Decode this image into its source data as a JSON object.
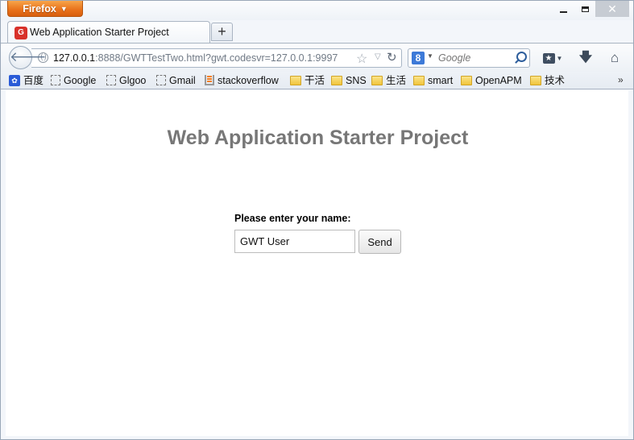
{
  "window": {
    "app_menu_label": "Firefox",
    "controls": {
      "minimize": "minimize",
      "maximize": "maximize",
      "close": "✕"
    }
  },
  "tabs": [
    {
      "title": "Web Application Starter Project",
      "active": true,
      "favicon": "gwt-favicon"
    }
  ],
  "new_tab_label": "+",
  "navbar": {
    "url_host": "127.0.0.1",
    "url_rest": ":8888/GWTTestTwo.html?gwt.codesvr=127.0.0.1:9997",
    "search_engine_icon": "8",
    "search_placeholder": "Google"
  },
  "bookmarks": {
    "items": [
      {
        "label": "百度",
        "icon": "baidu-icon"
      },
      {
        "label": "Google",
        "icon": "page-icon"
      },
      {
        "label": "Glgoo",
        "icon": "page-icon"
      },
      {
        "label": "Gmail",
        "icon": "page-icon"
      },
      {
        "label": "stackoverflow",
        "icon": "stackoverflow-icon"
      },
      {
        "label": "干活",
        "icon": "folder-icon"
      },
      {
        "label": "SNS",
        "icon": "folder-icon"
      },
      {
        "label": "生活",
        "icon": "folder-icon"
      },
      {
        "label": "smart",
        "icon": "folder-icon"
      },
      {
        "label": "OpenAPM",
        "icon": "folder-icon"
      },
      {
        "label": "技术",
        "icon": "folder-icon"
      }
    ],
    "overflow_label": "»"
  },
  "page": {
    "title": "Web Application Starter Project",
    "prompt": "Please enter your name:",
    "name_value": "GWT User",
    "send_label": "Send"
  },
  "colors": {
    "firefox_button": "#e8701a",
    "page_title": "#777777",
    "close_button": "#c7ccd3"
  }
}
